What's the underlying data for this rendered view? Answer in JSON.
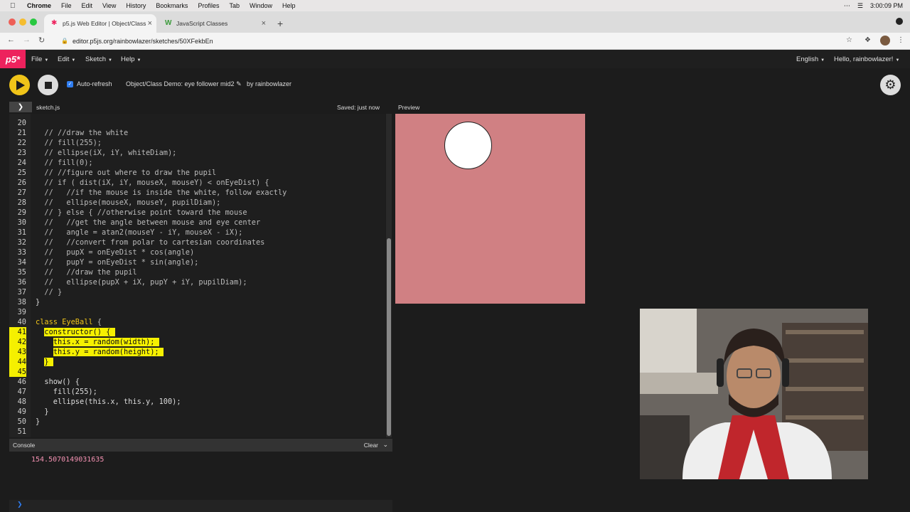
{
  "mac_menu": {
    "app": "Chrome",
    "items": [
      "File",
      "Edit",
      "View",
      "History",
      "Bookmarks",
      "Profiles",
      "Tab",
      "Window",
      "Help"
    ],
    "clock": "3:00:09 PM"
  },
  "browser": {
    "tabs": [
      {
        "title": "p5.js Web Editor | Object/Class",
        "active": true
      },
      {
        "title": "JavaScript Classes",
        "active": false
      }
    ],
    "url": "editor.p5js.org/rainbowlazer/sketches/50XFekbEn"
  },
  "p5nav": {
    "logo": "p5*",
    "menus": [
      "File",
      "Edit",
      "Sketch",
      "Help"
    ],
    "language": "English",
    "greeting": "Hello, rainbowlazer!"
  },
  "p5toolbar": {
    "auto_refresh": "Auto-refresh",
    "project_name": "Object/Class Demo: eye follower mid2",
    "byline": "by rainbowlazer"
  },
  "editor": {
    "filename": "sketch.js",
    "saved": "Saved: just now",
    "lines": [
      {
        "n": "20",
        "code": ""
      },
      {
        "n": "21",
        "code": "  // //draw the white"
      },
      {
        "n": "22",
        "code": "  // fill(255);"
      },
      {
        "n": "23",
        "code": "  // ellipse(iX, iY, whiteDiam);"
      },
      {
        "n": "24",
        "code": "  // fill(0);"
      },
      {
        "n": "25",
        "code": "  // //figure out where to draw the pupil"
      },
      {
        "n": "26",
        "code": "  // if ( dist(iX, iY, mouseX, mouseY) < onEyeDist) {"
      },
      {
        "n": "27",
        "code": "  //   //if the mouse is inside the white, follow exactly"
      },
      {
        "n": "28",
        "code": "  //   ellipse(mouseX, mouseY, pupilDiam);"
      },
      {
        "n": "29",
        "code": "  // } else { //otherwise point toward the mouse"
      },
      {
        "n": "30",
        "code": "  //   //get the angle between mouse and eye center"
      },
      {
        "n": "31",
        "code": "  //   angle = atan2(mouseY - iY, mouseX - iX);"
      },
      {
        "n": "32",
        "code": "  //   //convert from polar to cartesian coordinates"
      },
      {
        "n": "33",
        "code": "  //   pupX = onEyeDist * cos(angle)"
      },
      {
        "n": "34",
        "code": "  //   pupY = onEyeDist * sin(angle);"
      },
      {
        "n": "35",
        "code": "  //   //draw the pupil"
      },
      {
        "n": "36",
        "code": "  //   ellipse(pupX + iX, pupY + iY, pupilDiam);"
      },
      {
        "n": "37",
        "code": "  // }"
      },
      {
        "n": "38",
        "code": "}"
      },
      {
        "n": "39",
        "code": ""
      },
      {
        "n": "40",
        "code": "class EyeBall {"
      },
      {
        "n": "41",
        "code": "  constructor() {"
      },
      {
        "n": "42",
        "code": "    this.x = random(width);"
      },
      {
        "n": "43",
        "code": "    this.y = random(height);"
      },
      {
        "n": "44",
        "code": "  }"
      },
      {
        "n": "45",
        "code": ""
      },
      {
        "n": "46",
        "code": "  show() {"
      },
      {
        "n": "47",
        "code": "    fill(255);"
      },
      {
        "n": "48",
        "code": "    ellipse(this.x, this.y, 100);"
      },
      {
        "n": "49",
        "code": "  }"
      },
      {
        "n": "50",
        "code": "}"
      },
      {
        "n": "51",
        "code": ""
      }
    ]
  },
  "console": {
    "title": "Console",
    "clear": "Clear",
    "output": "154.5070149031635"
  },
  "preview": {
    "label": "Preview",
    "canvas_color": "#d08083"
  },
  "colors": {
    "accent": "#ed225d",
    "play": "#f0c419",
    "highlight": "#f5f000"
  }
}
